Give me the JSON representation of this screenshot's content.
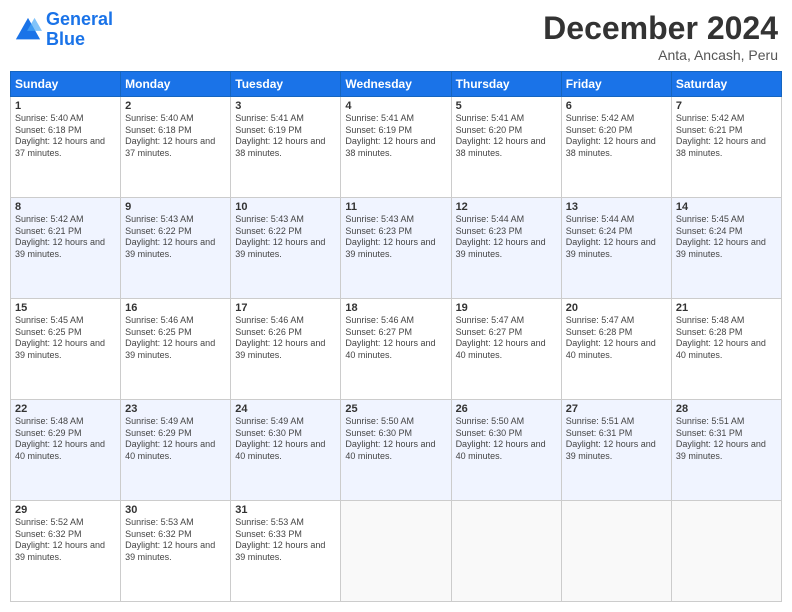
{
  "header": {
    "logo_line1": "General",
    "logo_line2": "Blue",
    "main_title": "December 2024",
    "sub_title": "Anta, Ancash, Peru"
  },
  "days_of_week": [
    "Sunday",
    "Monday",
    "Tuesday",
    "Wednesday",
    "Thursday",
    "Friday",
    "Saturday"
  ],
  "weeks": [
    [
      {
        "day": "1",
        "sunrise": "5:40 AM",
        "sunset": "6:18 PM",
        "daylight": "12 hours and 37 minutes."
      },
      {
        "day": "2",
        "sunrise": "5:40 AM",
        "sunset": "6:18 PM",
        "daylight": "12 hours and 37 minutes."
      },
      {
        "day": "3",
        "sunrise": "5:41 AM",
        "sunset": "6:19 PM",
        "daylight": "12 hours and 38 minutes."
      },
      {
        "day": "4",
        "sunrise": "5:41 AM",
        "sunset": "6:19 PM",
        "daylight": "12 hours and 38 minutes."
      },
      {
        "day": "5",
        "sunrise": "5:41 AM",
        "sunset": "6:20 PM",
        "daylight": "12 hours and 38 minutes."
      },
      {
        "day": "6",
        "sunrise": "5:42 AM",
        "sunset": "6:20 PM",
        "daylight": "12 hours and 38 minutes."
      },
      {
        "day": "7",
        "sunrise": "5:42 AM",
        "sunset": "6:21 PM",
        "daylight": "12 hours and 38 minutes."
      }
    ],
    [
      {
        "day": "8",
        "sunrise": "5:42 AM",
        "sunset": "6:21 PM",
        "daylight": "12 hours and 39 minutes."
      },
      {
        "day": "9",
        "sunrise": "5:43 AM",
        "sunset": "6:22 PM",
        "daylight": "12 hours and 39 minutes."
      },
      {
        "day": "10",
        "sunrise": "5:43 AM",
        "sunset": "6:22 PM",
        "daylight": "12 hours and 39 minutes."
      },
      {
        "day": "11",
        "sunrise": "5:43 AM",
        "sunset": "6:23 PM",
        "daylight": "12 hours and 39 minutes."
      },
      {
        "day": "12",
        "sunrise": "5:44 AM",
        "sunset": "6:23 PM",
        "daylight": "12 hours and 39 minutes."
      },
      {
        "day": "13",
        "sunrise": "5:44 AM",
        "sunset": "6:24 PM",
        "daylight": "12 hours and 39 minutes."
      },
      {
        "day": "14",
        "sunrise": "5:45 AM",
        "sunset": "6:24 PM",
        "daylight": "12 hours and 39 minutes."
      }
    ],
    [
      {
        "day": "15",
        "sunrise": "5:45 AM",
        "sunset": "6:25 PM",
        "daylight": "12 hours and 39 minutes."
      },
      {
        "day": "16",
        "sunrise": "5:46 AM",
        "sunset": "6:25 PM",
        "daylight": "12 hours and 39 minutes."
      },
      {
        "day": "17",
        "sunrise": "5:46 AM",
        "sunset": "6:26 PM",
        "daylight": "12 hours and 39 minutes."
      },
      {
        "day": "18",
        "sunrise": "5:46 AM",
        "sunset": "6:27 PM",
        "daylight": "12 hours and 40 minutes."
      },
      {
        "day": "19",
        "sunrise": "5:47 AM",
        "sunset": "6:27 PM",
        "daylight": "12 hours and 40 minutes."
      },
      {
        "day": "20",
        "sunrise": "5:47 AM",
        "sunset": "6:28 PM",
        "daylight": "12 hours and 40 minutes."
      },
      {
        "day": "21",
        "sunrise": "5:48 AM",
        "sunset": "6:28 PM",
        "daylight": "12 hours and 40 minutes."
      }
    ],
    [
      {
        "day": "22",
        "sunrise": "5:48 AM",
        "sunset": "6:29 PM",
        "daylight": "12 hours and 40 minutes."
      },
      {
        "day": "23",
        "sunrise": "5:49 AM",
        "sunset": "6:29 PM",
        "daylight": "12 hours and 40 minutes."
      },
      {
        "day": "24",
        "sunrise": "5:49 AM",
        "sunset": "6:30 PM",
        "daylight": "12 hours and 40 minutes."
      },
      {
        "day": "25",
        "sunrise": "5:50 AM",
        "sunset": "6:30 PM",
        "daylight": "12 hours and 40 minutes."
      },
      {
        "day": "26",
        "sunrise": "5:50 AM",
        "sunset": "6:30 PM",
        "daylight": "12 hours and 40 minutes."
      },
      {
        "day": "27",
        "sunrise": "5:51 AM",
        "sunset": "6:31 PM",
        "daylight": "12 hours and 39 minutes."
      },
      {
        "day": "28",
        "sunrise": "5:51 AM",
        "sunset": "6:31 PM",
        "daylight": "12 hours and 39 minutes."
      }
    ],
    [
      {
        "day": "29",
        "sunrise": "5:52 AM",
        "sunset": "6:32 PM",
        "daylight": "12 hours and 39 minutes."
      },
      {
        "day": "30",
        "sunrise": "5:53 AM",
        "sunset": "6:32 PM",
        "daylight": "12 hours and 39 minutes."
      },
      {
        "day": "31",
        "sunrise": "5:53 AM",
        "sunset": "6:33 PM",
        "daylight": "12 hours and 39 minutes."
      },
      null,
      null,
      null,
      null
    ]
  ]
}
